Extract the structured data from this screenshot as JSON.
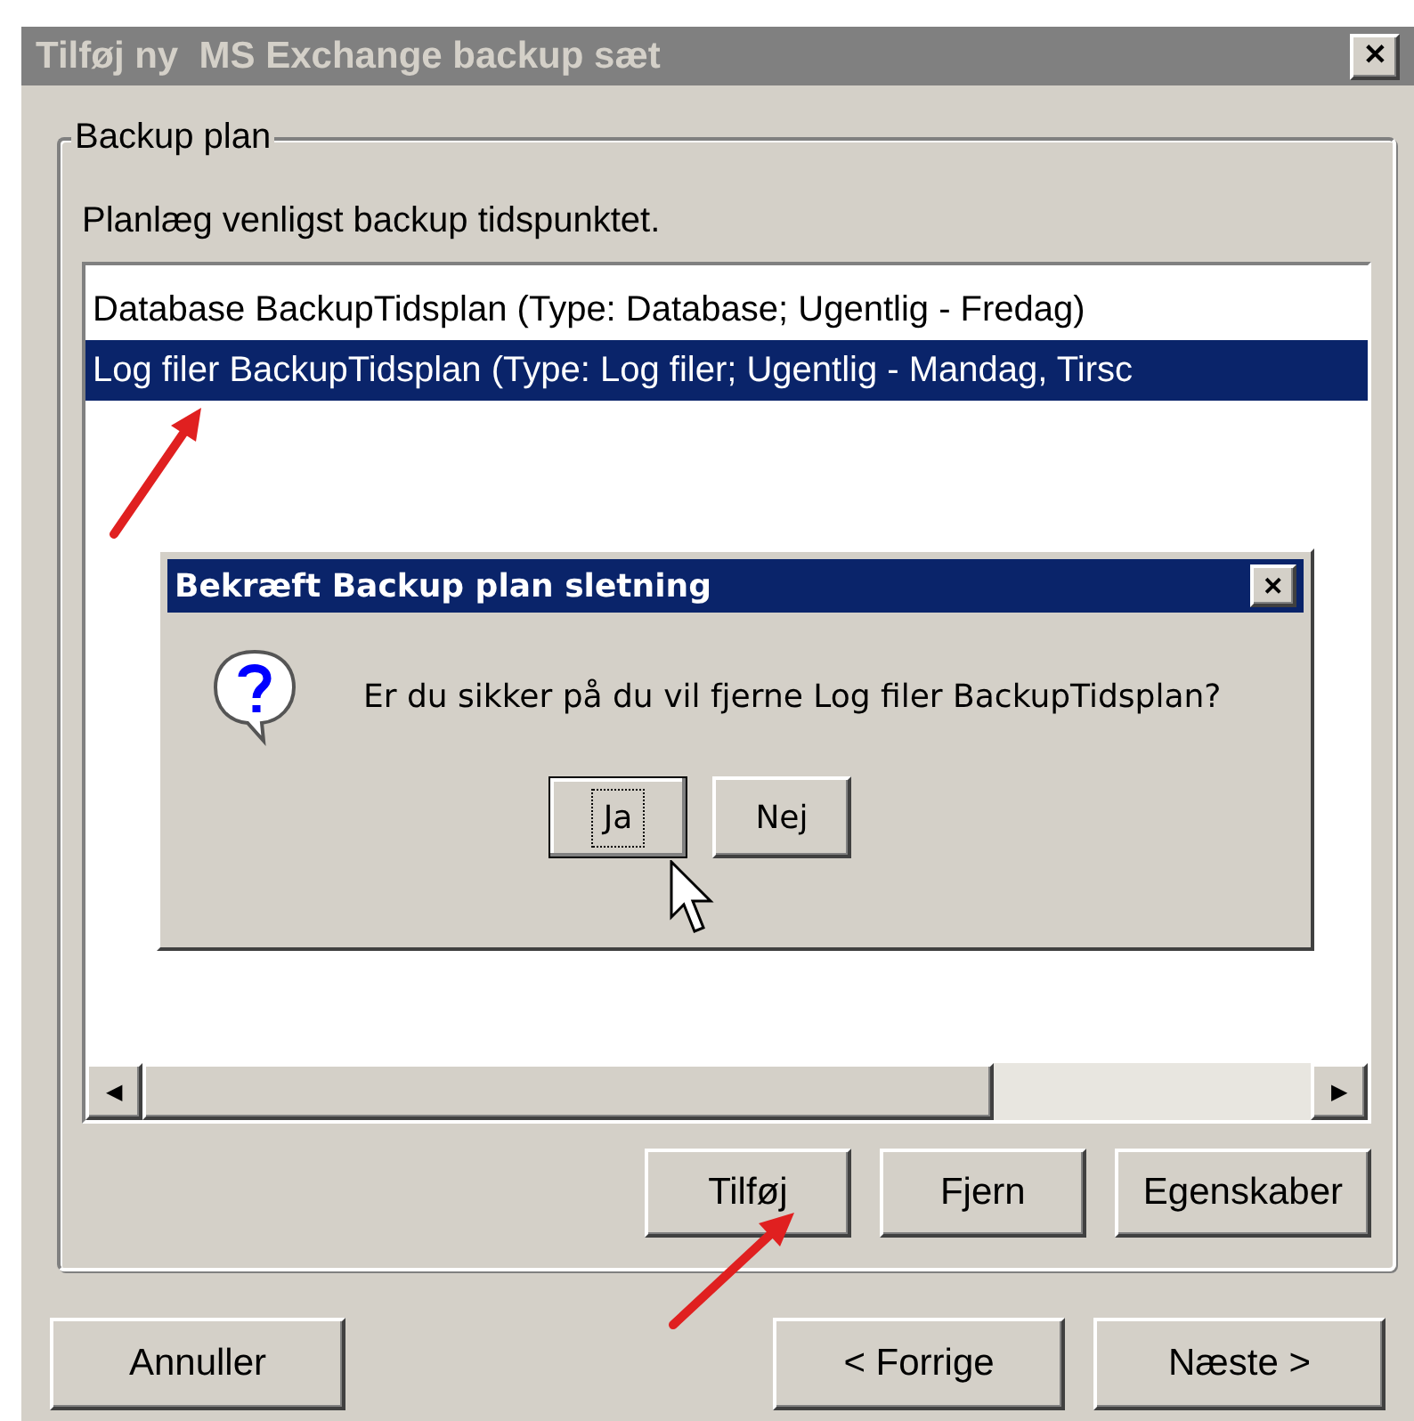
{
  "window": {
    "title": "Tilføj ny  MS Exchange backup sæt",
    "close": "✕"
  },
  "group": {
    "label": "Backup plan",
    "instruction": "Planlæg venligst backup tidspunktet."
  },
  "list": {
    "items": [
      {
        "label": "Database BackupTidsplan (Type: Database; Ugentlig - Fredag)",
        "selected": false
      },
      {
        "label": "Log filer BackupTidsplan (Type: Log filer; Ugentlig - Mandag, Tirsc",
        "selected": true
      }
    ],
    "scroll_left": "◀",
    "scroll_right": "▶"
  },
  "list_buttons": [
    {
      "label": "Tilføj"
    },
    {
      "label": "Fjern"
    },
    {
      "label": "Egenskaber"
    }
  ],
  "nav_buttons": [
    {
      "label": "Annuller"
    },
    {
      "label": "< Forrige"
    },
    {
      "label": "Næste >"
    }
  ],
  "dialog": {
    "title": "Bekræft Backup plan sletning",
    "close": "✕",
    "message": "Er du sikker på du vil fjerne Log filer BackupTidsplan?",
    "buttons": [
      {
        "label": "Ja",
        "focused": true
      },
      {
        "label": "Nej",
        "focused": false
      }
    ]
  }
}
